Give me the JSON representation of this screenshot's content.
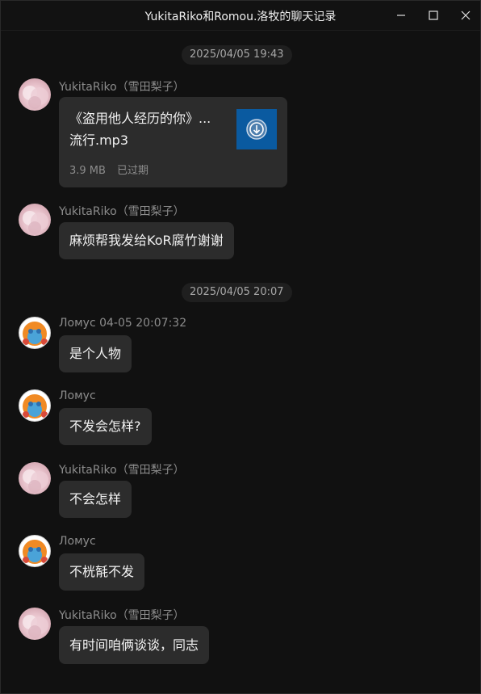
{
  "window": {
    "title": "YukitaRiko和Romou.洛牧的聊天记录"
  },
  "timestamps": [
    "2025/04/05 19:43",
    "2025/04/05 20:07"
  ],
  "file": {
    "name": "《盗用他人经历的你》... 流行.mp3",
    "size": "3.9 MB",
    "status": "已过期"
  },
  "messages": [
    {
      "sender": "YukitaRiko（雪田梨子）"
    },
    {
      "sender": "YukitaRiko（雪田梨子）",
      "text": "麻烦帮我发给KoR腐竹谢谢"
    },
    {
      "sender": "Ломус 04-05 20:07:32",
      "text": "是个人物"
    },
    {
      "sender": "Ломус",
      "text": "不发会怎样?"
    },
    {
      "sender": "YukitaRiko（雪田梨子）",
      "text": "不会怎样"
    },
    {
      "sender": "Ломус",
      "text": "不桄毻不发"
    },
    {
      "sender": "YukitaRiko（雪田梨子）",
      "text": "有时间咱俩谈谈，同志"
    }
  ],
  "colors": {
    "background": "#111111",
    "bubble": "#2c2c2c",
    "file_icon": "#0a5aa0"
  }
}
